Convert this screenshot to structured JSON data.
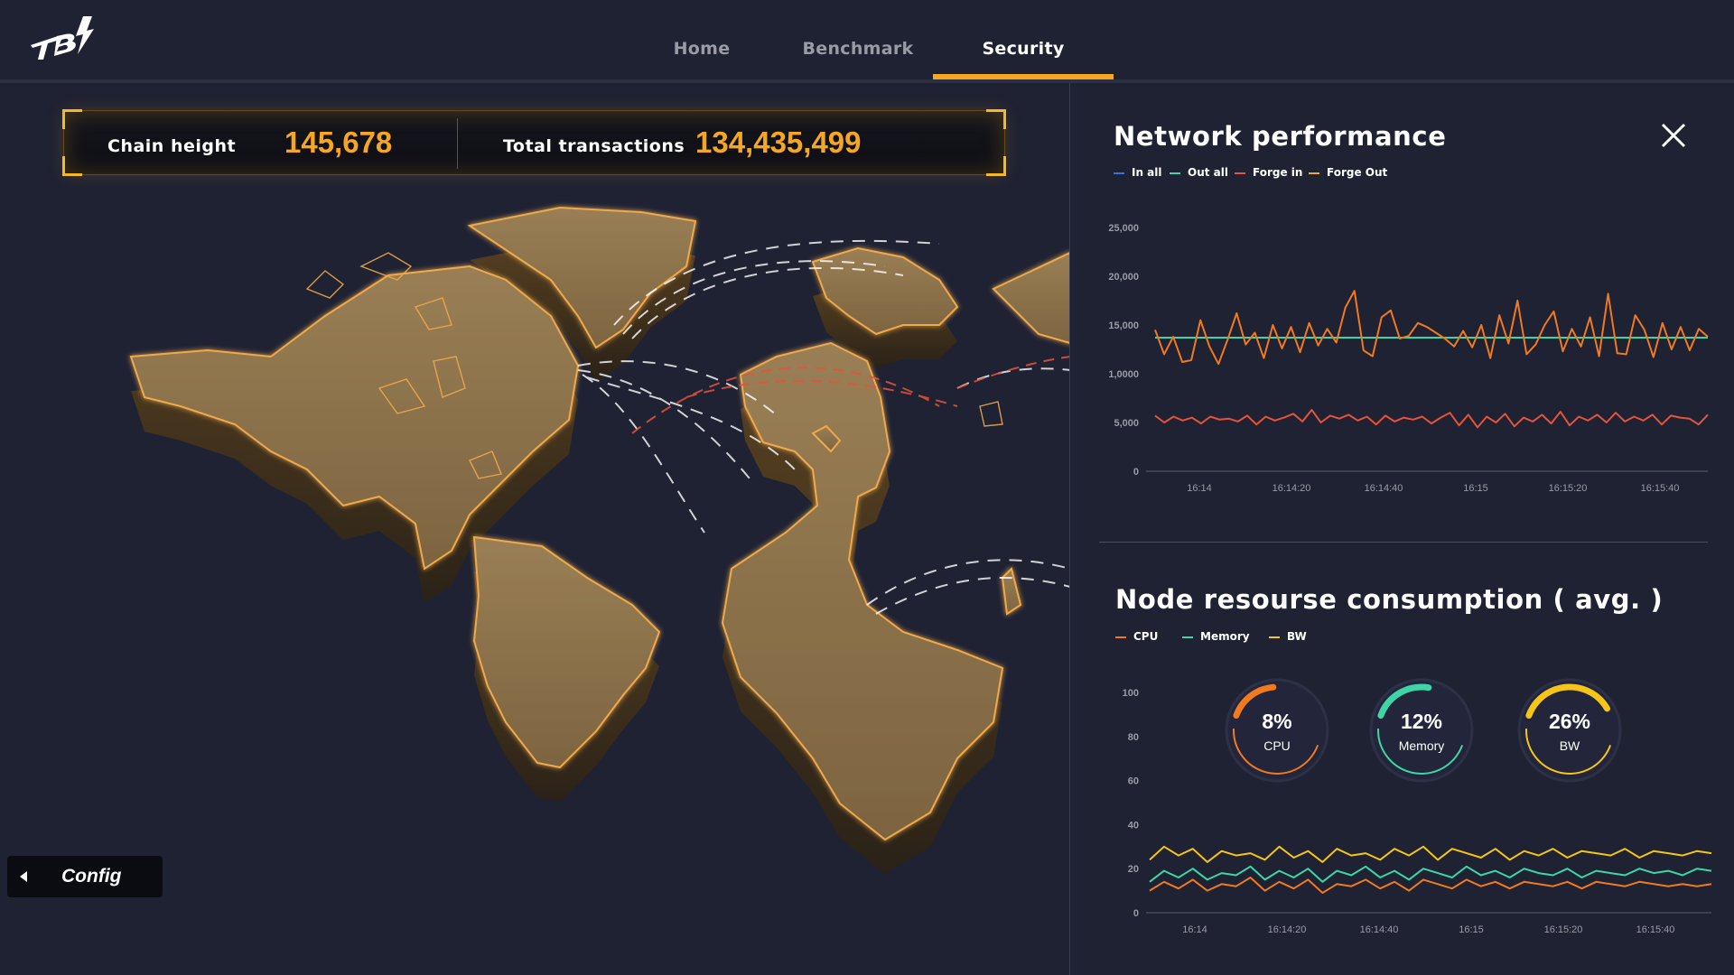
{
  "nav": {
    "items": [
      {
        "label": "Home",
        "active": false
      },
      {
        "label": "Benchmark",
        "active": false
      },
      {
        "label": "Security",
        "active": true
      }
    ]
  },
  "stats": {
    "chain_height_label": "Chain height",
    "chain_height_value": "145,678",
    "total_tx_label": "Total transactions",
    "total_tx_value": "134,435,499"
  },
  "config": {
    "label": "Config"
  },
  "network": {
    "title": "Network performance",
    "legend": [
      {
        "name": "In all",
        "color": "#3b6fe0"
      },
      {
        "name": "Out all",
        "color": "#3ed6a8"
      },
      {
        "name": "Forge in",
        "color": "#e4533d"
      },
      {
        "name": "Forge Out",
        "color": "#f5a623"
      }
    ]
  },
  "node": {
    "title": "Node resourse consumption ( avg. )",
    "legend": [
      {
        "name": "CPU",
        "color": "#f07a22"
      },
      {
        "name": "Memory",
        "color": "#3ed6a8"
      },
      {
        "name": "BW",
        "color": "#f5c518"
      }
    ],
    "gauges": [
      {
        "value": 8,
        "text": "8%",
        "label": "CPU",
        "color": "#f07a22"
      },
      {
        "value": 12,
        "text": "12%",
        "label": "Memory",
        "color": "#3ed6a8"
      },
      {
        "value": 26,
        "text": "26%",
        "label": "BW",
        "color": "#f5c518"
      }
    ]
  },
  "colors": {
    "accent": "#f5a623",
    "background": "#1f2233",
    "map_land": "#8a7048"
  },
  "chart_data": [
    {
      "type": "line",
      "title": "Network performance",
      "x": [
        "16:14",
        "16:14:20",
        "16:14:40",
        "16:15",
        "16:15:20",
        "16:15:40"
      ],
      "y_ticks": [
        "0",
        "5,000",
        "1,0000",
        "15,000",
        "20,000",
        "25,000"
      ],
      "ylim": [
        0,
        25000
      ],
      "grid": false,
      "series": [
        {
          "name": "Out all",
          "color": "#3ed6a8",
          "values": [
            13700,
            13700,
            13700,
            13700,
            13700,
            13700,
            13700,
            13700,
            13700,
            13700,
            13700,
            13700,
            13700,
            13700,
            13700,
            13700,
            13700,
            13700,
            13700,
            13700,
            13700,
            13700,
            13700,
            13700,
            13700,
            13700,
            13700,
            13700,
            13700,
            13700,
            13700,
            13700,
            13700,
            13700,
            13700,
            13700,
            13700,
            13700,
            13700,
            13700,
            13700,
            13700,
            13700,
            13700,
            13700,
            13700,
            13700,
            13700,
            13700,
            13700
          ]
        },
        {
          "name": "Forge in",
          "color": "#f07a22",
          "values": [
            14500,
            12000,
            13800,
            11200,
            11400,
            15500,
            12800,
            11000,
            13500,
            16200,
            13000,
            14200,
            11600,
            15000,
            12600,
            14800,
            12200,
            15200,
            12900,
            14600,
            13200,
            16800,
            18500,
            12400,
            11800,
            15800,
            16500,
            13600,
            13900,
            15200,
            14800,
            14200,
            13600,
            12800,
            14400,
            12700,
            15000,
            11600,
            16000,
            13100,
            17500,
            12000,
            13000,
            15000,
            16400,
            12300,
            14600,
            12800,
            15800,
            11800,
            18200,
            12100,
            12000,
            16000,
            14500,
            11700,
            15200,
            12500,
            14800,
            12400,
            14600,
            13800
          ]
        },
        {
          "name": "Forge Out",
          "color": "#e4533d",
          "values": [
            5700,
            5000,
            5600,
            5200,
            5500,
            4900,
            5600,
            5300,
            5400,
            5100,
            5700,
            4800,
            5600,
            5200,
            5500,
            5900,
            5100,
            6300,
            5000,
            5700,
            5400,
            5800,
            5200,
            5600,
            4800,
            5700,
            5100,
            5500,
            5300,
            5600,
            4900,
            5500,
            6000,
            4700,
            5800,
            4500,
            5600,
            5000,
            5900,
            4600,
            5500,
            5100,
            5800,
            4900,
            6100,
            4700,
            5600,
            5200,
            5800,
            5000,
            6000,
            5100,
            5600,
            5200,
            5800,
            4800,
            5700,
            5500,
            5400,
            4800,
            5800
          ]
        }
      ]
    },
    {
      "type": "line",
      "title": "Node resourse consumption ( avg. )",
      "x": [
        "16:14",
        "16:14:20",
        "16:14:40",
        "16:15",
        "16:15:20",
        "16:15:40"
      ],
      "y_ticks": [
        "0",
        "20",
        "40",
        "60",
        "80",
        "100"
      ],
      "ylim": [
        0,
        100
      ],
      "grid": false,
      "series": [
        {
          "name": "BW",
          "color": "#f5c518",
          "values": [
            24,
            30,
            26,
            29,
            23,
            28,
            26,
            27,
            24,
            30,
            25,
            28,
            23,
            29,
            26,
            27,
            24,
            29,
            26,
            30,
            24,
            29,
            27,
            25,
            29,
            24,
            28,
            26,
            29,
            25,
            28,
            27,
            26,
            29,
            25,
            28,
            27,
            26,
            28,
            27
          ]
        },
        {
          "name": "Memory",
          "color": "#3ed6a8",
          "values": [
            14,
            19,
            16,
            20,
            15,
            18,
            17,
            21,
            15,
            19,
            16,
            20,
            14,
            19,
            17,
            21,
            16,
            19,
            15,
            20,
            18,
            16,
            21,
            17,
            19,
            16,
            20,
            18,
            17,
            20,
            16,
            19,
            18,
            17,
            20,
            18,
            19,
            17,
            20,
            19
          ]
        },
        {
          "name": "CPU",
          "color": "#f07a22",
          "values": [
            10,
            14,
            11,
            15,
            10,
            13,
            12,
            16,
            10,
            14,
            11,
            15,
            9,
            13,
            12,
            15,
            11,
            14,
            10,
            15,
            13,
            11,
            15,
            12,
            14,
            11,
            14,
            13,
            12,
            14,
            11,
            14,
            13,
            12,
            14,
            13,
            12,
            13,
            12,
            13
          ]
        }
      ]
    }
  ]
}
